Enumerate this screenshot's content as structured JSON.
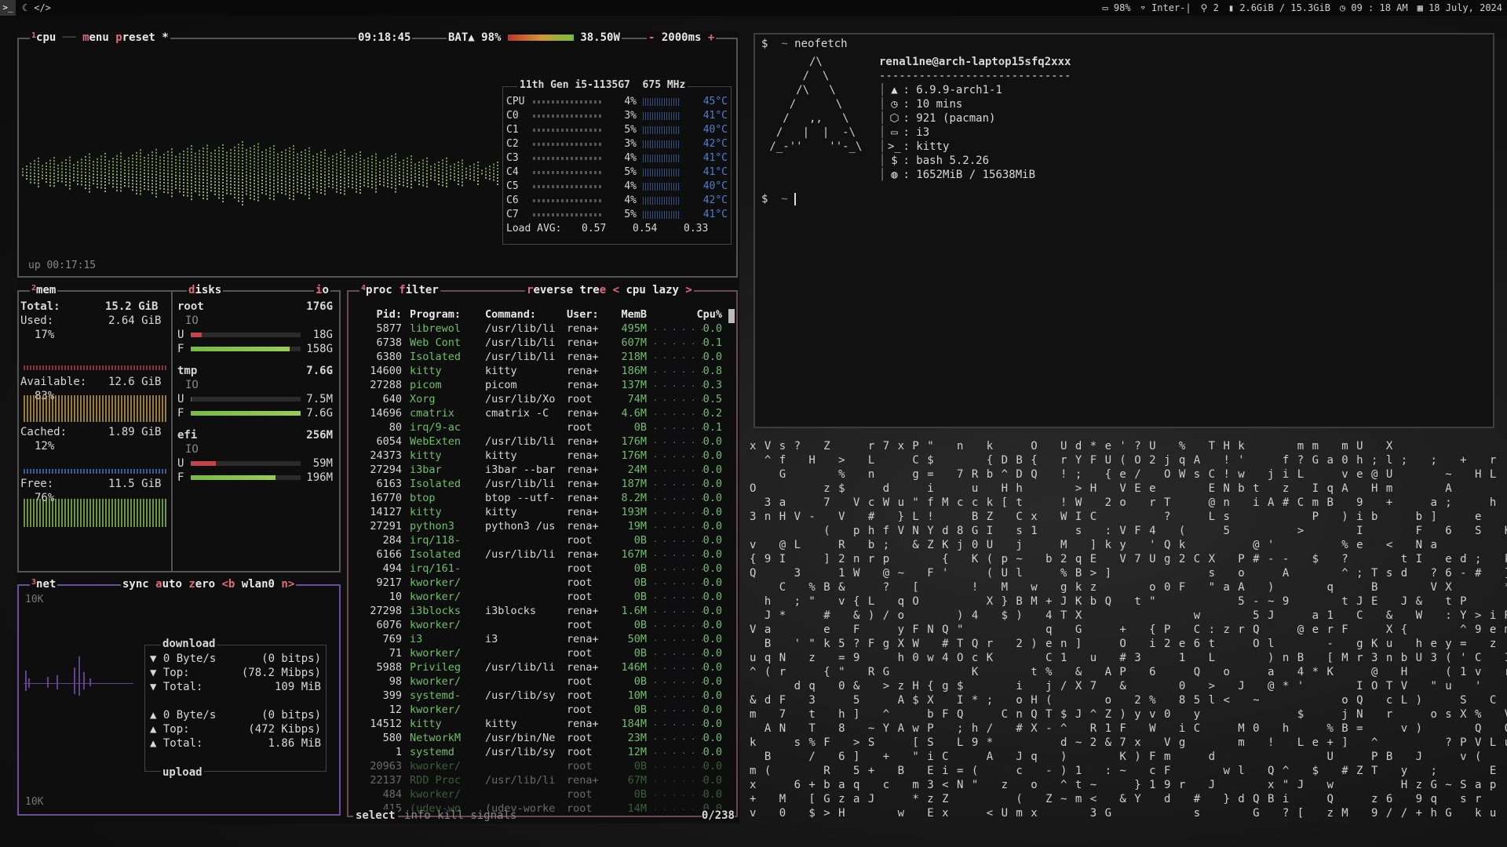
{
  "topbar": {
    "icons": [
      "terminal-icon",
      "moon-icon",
      "code-icon"
    ],
    "battery": "98%",
    "wifi": "Inter-|",
    "indicator": "2",
    "memory": "2.6GiB / 15.3GiB",
    "time": "09 : 18 AM",
    "date": "18 July, 2024"
  },
  "cpu": {
    "title_num": "1",
    "title_cpu": "cpu",
    "title_menu": "menu",
    "title_preset": "preset *",
    "clock": "09:18:45",
    "battery_label": "BAT▲ 98%",
    "power": "38.50W",
    "interval": "2000ms",
    "minus": "-",
    "plus": "+",
    "model": "11th Gen i5-1135G7",
    "freq": "675 MHz",
    "cores": [
      {
        "name": "CPU",
        "pct": "4%",
        "temp": "45°C",
        "value": 4
      },
      {
        "name": "C0",
        "pct": "3%",
        "temp": "41°C",
        "value": 3
      },
      {
        "name": "C1",
        "pct": "5%",
        "temp": "40°C",
        "value": 5
      },
      {
        "name": "C2",
        "pct": "3%",
        "temp": "42°C",
        "value": 3
      },
      {
        "name": "C3",
        "pct": "4%",
        "temp": "41°C",
        "value": 4
      },
      {
        "name": "C4",
        "pct": "5%",
        "temp": "41°C",
        "value": 5
      },
      {
        "name": "C5",
        "pct": "4%",
        "temp": "40°C",
        "value": 4
      },
      {
        "name": "C6",
        "pct": "4%",
        "temp": "42°C",
        "value": 4
      },
      {
        "name": "C7",
        "pct": "5%",
        "temp": "41°C",
        "value": 5
      }
    ],
    "load_label": "Load AVG:",
    "load": [
      "0.57",
      "0.54",
      "0.33"
    ],
    "uptime": "up 00:17:15"
  },
  "mem": {
    "title_num": "2",
    "title": "mem",
    "total_label": "Total:",
    "total": "15.2 GiB",
    "used_label": "Used:",
    "used": "2.64 GiB",
    "used_pct": "17%",
    "avail_label": "Available:",
    "avail": "12.6 GiB",
    "avail_pct": "83%",
    "cached_label": "Cached:",
    "cached": "1.89 GiB",
    "cached_pct": "12%",
    "free_label": "Free:",
    "free": "11.5 GiB",
    "free_pct": "76%"
  },
  "disks": {
    "title": "disks",
    "io_tab": "io",
    "io_label": "IO",
    "items": [
      {
        "name": "root",
        "size": "176G",
        "used": "18G",
        "free": "158G",
        "used_frac": 0.1,
        "free_frac": 0.9
      },
      {
        "name": "tmp",
        "size": "7.6G",
        "used": "7.5M",
        "free": "7.6G",
        "used_frac": 0.01,
        "free_frac": 1.0
      },
      {
        "name": "efi",
        "size": "256M",
        "used": "59M",
        "free": "196M",
        "used_frac": 0.23,
        "free_frac": 0.77
      }
    ]
  },
  "net": {
    "title_num": "3",
    "title": "net",
    "sync": "sync",
    "auto": "auto",
    "zero": "zero",
    "prev": "<b",
    "iface": "wlan0",
    "next": "n>",
    "scale_top": "10K",
    "scale_bottom": "10K",
    "download_label": "download",
    "upload_label": "upload",
    "dl_rate": "0 Byte/s",
    "dl_bits": "(0 bitps)",
    "dl_top_label": "Top:",
    "dl_top": "(78.2 Mibps)",
    "dl_total_label": "Total:",
    "dl_total": "109 MiB",
    "ul_rate": "0 Byte/s",
    "ul_bits": "(0 bitps)",
    "ul_top_label": "Top:",
    "ul_top": "(472 Kibps)",
    "ul_total_label": "Total:",
    "ul_total": "1.86 MiB"
  },
  "proc": {
    "title_num": "4",
    "title": "proc",
    "filter": "filter",
    "reverse": "reverse",
    "tree": "tree",
    "sort": "cpu lazy",
    "sort_prev": "<",
    "sort_next": ">",
    "headers": {
      "pid": "Pid:",
      "prog": "Program:",
      "cmd": "Command:",
      "user": "User:",
      "mem": "MemB",
      "cpu": "Cpu%"
    },
    "rows": [
      {
        "pid": "5877",
        "prog": "librewol",
        "cmd": "/usr/lib/li",
        "user": "rena+",
        "mem": "495M",
        "cpu": "0.0"
      },
      {
        "pid": "6738",
        "prog": "Web Cont",
        "cmd": "/usr/lib/li",
        "user": "rena+",
        "mem": "607M",
        "cpu": "0.1"
      },
      {
        "pid": "6380",
        "prog": "Isolated",
        "cmd": "/usr/lib/li",
        "user": "rena+",
        "mem": "218M",
        "cpu": "0.0"
      },
      {
        "pid": "14600",
        "prog": "kitty",
        "cmd": "kitty",
        "user": "rena+",
        "mem": "186M",
        "cpu": "0.8"
      },
      {
        "pid": "27288",
        "prog": "picom",
        "cmd": "picom",
        "user": "rena+",
        "mem": "137M",
        "cpu": "0.3"
      },
      {
        "pid": "640",
        "prog": "Xorg",
        "cmd": "/usr/lib/Xo",
        "user": "root",
        "mem": "74M",
        "cpu": "0.5"
      },
      {
        "pid": "14696",
        "prog": "cmatrix",
        "cmd": "cmatrix -C",
        "user": "rena+",
        "mem": "4.6M",
        "cpu": "0.2"
      },
      {
        "pid": "80",
        "prog": "irq/9-ac",
        "cmd": "",
        "user": "root",
        "mem": "0B",
        "cpu": "0.1"
      },
      {
        "pid": "6054",
        "prog": "WebExten",
        "cmd": "/usr/lib/li",
        "user": "rena+",
        "mem": "176M",
        "cpu": "0.0"
      },
      {
        "pid": "24373",
        "prog": "kitty",
        "cmd": "kitty",
        "user": "rena+",
        "mem": "176M",
        "cpu": "0.0"
      },
      {
        "pid": "27294",
        "prog": "i3bar",
        "cmd": "i3bar --bar",
        "user": "rena+",
        "mem": "24M",
        "cpu": "0.0"
      },
      {
        "pid": "6163",
        "prog": "Isolated",
        "cmd": "/usr/lib/li",
        "user": "rena+",
        "mem": "187M",
        "cpu": "0.0"
      },
      {
        "pid": "16770",
        "prog": "btop",
        "cmd": "btop --utf-",
        "user": "rena+",
        "mem": "8.2M",
        "cpu": "0.0"
      },
      {
        "pid": "14127",
        "prog": "kitty",
        "cmd": "kitty",
        "user": "rena+",
        "mem": "193M",
        "cpu": "0.0"
      },
      {
        "pid": "27291",
        "prog": "python3",
        "cmd": "python3 /us",
        "user": "rena+",
        "mem": "19M",
        "cpu": "0.0"
      },
      {
        "pid": "284",
        "prog": "irq/118-",
        "cmd": "",
        "user": "root",
        "mem": "0B",
        "cpu": "0.0"
      },
      {
        "pid": "6166",
        "prog": "Isolated",
        "cmd": "/usr/lib/li",
        "user": "rena+",
        "mem": "167M",
        "cpu": "0.0"
      },
      {
        "pid": "494",
        "prog": "irq/161-",
        "cmd": "",
        "user": "root",
        "mem": "0B",
        "cpu": "0.0"
      },
      {
        "pid": "9217",
        "prog": "kworker/",
        "cmd": "",
        "user": "root",
        "mem": "0B",
        "cpu": "0.0"
      },
      {
        "pid": "10",
        "prog": "kworker/",
        "cmd": "",
        "user": "root",
        "mem": "0B",
        "cpu": "0.0"
      },
      {
        "pid": "27298",
        "prog": "i3blocks",
        "cmd": "i3blocks",
        "user": "rena+",
        "mem": "1.6M",
        "cpu": "0.0"
      },
      {
        "pid": "6076",
        "prog": "kworker/",
        "cmd": "",
        "user": "root",
        "mem": "0B",
        "cpu": "0.0"
      },
      {
        "pid": "769",
        "prog": "i3",
        "cmd": "i3",
        "user": "rena+",
        "mem": "50M",
        "cpu": "0.0"
      },
      {
        "pid": "71",
        "prog": "kworker/",
        "cmd": "",
        "user": "root",
        "mem": "0B",
        "cpu": "0.0"
      },
      {
        "pid": "5988",
        "prog": "Privileg",
        "cmd": "/usr/lib/li",
        "user": "rena+",
        "mem": "146M",
        "cpu": "0.0"
      },
      {
        "pid": "98",
        "prog": "kworker/",
        "cmd": "",
        "user": "root",
        "mem": "0B",
        "cpu": "0.0"
      },
      {
        "pid": "399",
        "prog": "systemd-",
        "cmd": "/usr/lib/sy",
        "user": "root",
        "mem": "10M",
        "cpu": "0.0"
      },
      {
        "pid": "12",
        "prog": "kworker/",
        "cmd": "",
        "user": "root",
        "mem": "0B",
        "cpu": "0.0"
      },
      {
        "pid": "14512",
        "prog": "kitty",
        "cmd": "kitty",
        "user": "rena+",
        "mem": "184M",
        "cpu": "0.0"
      },
      {
        "pid": "580",
        "prog": "NetworkM",
        "cmd": "/usr/bin/Ne",
        "user": "root",
        "mem": "23M",
        "cpu": "0.0"
      },
      {
        "pid": "1",
        "prog": "systemd",
        "cmd": "/usr/lib/sy",
        "user": "root",
        "mem": "12M",
        "cpu": "0.0"
      },
      {
        "pid": "20963",
        "prog": "kworker/",
        "cmd": "",
        "user": "root",
        "mem": "0B",
        "cpu": "0.0"
      },
      {
        "pid": "22137",
        "prog": "RDD Proc",
        "cmd": "/usr/lib/li",
        "user": "rena+",
        "mem": "67M",
        "cpu": "0.0"
      },
      {
        "pid": "484",
        "prog": "kworker/",
        "cmd": "",
        "user": "root",
        "mem": "0B",
        "cpu": "0.0"
      },
      {
        "pid": "415",
        "prog": "(udev-wo",
        "cmd": "(udev-worke",
        "user": "root",
        "mem": "14M",
        "cpu": "0.0"
      }
    ],
    "footer_select": "select",
    "footer_info": "info",
    "footer_kill": "kill",
    "footer_signals": "signals",
    "footer_count": "0/238"
  },
  "terminal": {
    "prompt": "$",
    "arrow": "~",
    "command": "neofetch",
    "user_host": "renal1ne@arch-laptop15sfq2xxx",
    "separator": "-----------------------------",
    "info": [
      {
        "icon": "arch-icon",
        "text": "6.9.9-arch1-1"
      },
      {
        "icon": "clock-icon",
        "text": "10 mins"
      },
      {
        "icon": "package-icon",
        "text": "921 (pacman)"
      },
      {
        "icon": "window-icon",
        "text": "i3"
      },
      {
        "icon": "terminal-icon",
        "text": "kitty"
      },
      {
        "icon": "dollar-icon",
        "text": "bash 5.2.26"
      },
      {
        "icon": "memory-icon",
        "text": "1652MiB / 15638MiB"
      }
    ]
  }
}
